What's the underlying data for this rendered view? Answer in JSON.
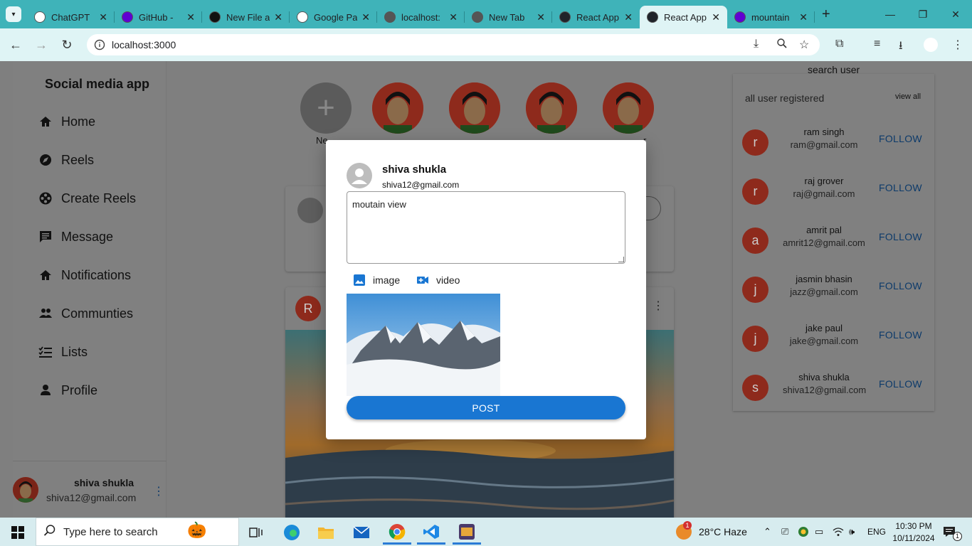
{
  "tabs": [
    {
      "title": "ChatGPT",
      "color": "#ffffff"
    },
    {
      "title": "GitHub - ",
      "color": "#6001d2"
    },
    {
      "title": "New File a",
      "color": "#111111"
    },
    {
      "title": "Google Pa",
      "color": "#ffffff"
    },
    {
      "title": "localhost:",
      "color": "#555555"
    },
    {
      "title": "New Tab",
      "color": "#555555"
    },
    {
      "title": "React App",
      "color": "#20232a"
    },
    {
      "title": "React App",
      "color": "#20232a"
    },
    {
      "title": "mountain",
      "color": "#6001d2"
    }
  ],
  "address": {
    "url": "localhost:3000"
  },
  "sidebar": {
    "brand": "Social media app",
    "items": [
      {
        "label": "Home",
        "icon": "home-icon"
      },
      {
        "label": "Reels",
        "icon": "compass-icon"
      },
      {
        "label": "Create Reels",
        "icon": "film-reel-icon"
      },
      {
        "label": "Message",
        "icon": "message-icon"
      },
      {
        "label": "Notifications",
        "icon": "home-icon"
      },
      {
        "label": "Communties",
        "icon": "people-icon"
      },
      {
        "label": "Lists",
        "icon": "checklist-icon"
      },
      {
        "label": "Profile",
        "icon": "person-icon"
      }
    ],
    "user": {
      "name": "shiva shukla",
      "email": "shiva12@gmail.com"
    }
  },
  "stories": {
    "new_label": "Ne",
    "last_label": "r"
  },
  "post": {
    "author_initial": "R"
  },
  "right": {
    "search_label": "search user",
    "title": "all user registered",
    "view_all": "view all",
    "follow_label": "FOLLOW",
    "users": [
      {
        "initial": "r",
        "name": "ram singh",
        "email": "ram@gmail.com"
      },
      {
        "initial": "r",
        "name": "raj grover",
        "email": "raj@gmail.com"
      },
      {
        "initial": "a",
        "name": "amrit pal",
        "email": "amrit12@gmail.com"
      },
      {
        "initial": "j",
        "name": "jasmin bhasin",
        "email": "jazz@gmail.com"
      },
      {
        "initial": "j",
        "name": "jake paul",
        "email": "jake@gmail.com"
      },
      {
        "initial": "s",
        "name": "shiva shukla",
        "email": "shiva12@gmail.com"
      }
    ]
  },
  "modal": {
    "name": "shiva shukla",
    "email": "shiva12@gmail.com",
    "text": "moutain view",
    "image_label": "image",
    "video_label": "video",
    "post_label": "POST"
  },
  "taskbar": {
    "search_placeholder": "Type here to search",
    "weather": "28°C  Haze",
    "lang": "ENG",
    "time": "10:30 PM",
    "date": "10/11/2024",
    "weather_badge": "1",
    "notif_badge": "1"
  },
  "colors": {
    "accent": "#1976d2",
    "tab_bar": "#3fb3b9",
    "overlay": "#7f7f7f"
  }
}
